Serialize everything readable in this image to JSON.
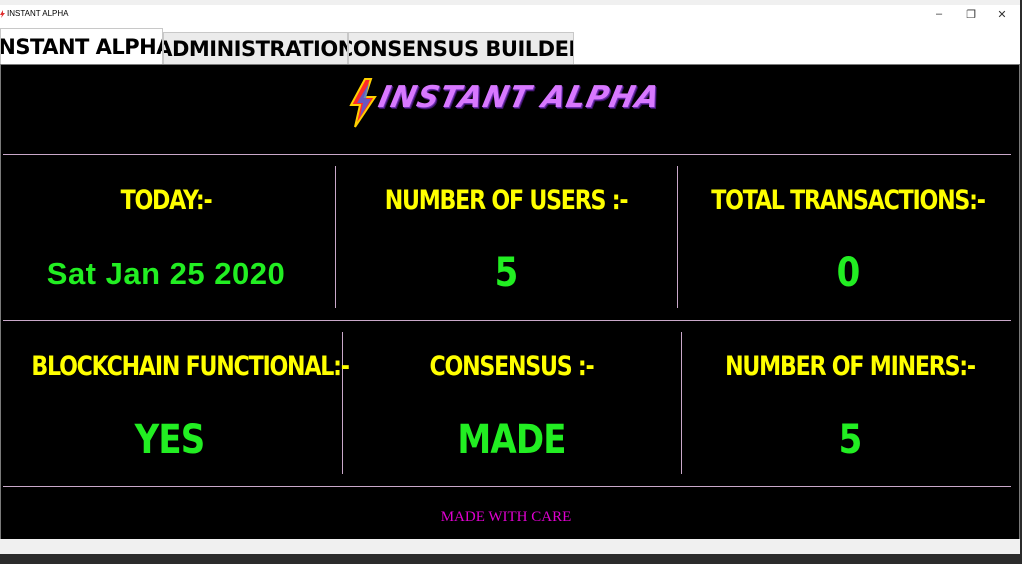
{
  "window": {
    "title": "INSTANT ALPHA",
    "controls": {
      "minimize": "–",
      "maximize": "❐",
      "close": "✕"
    }
  },
  "tabs": [
    {
      "label": "INSTANT ALPHA",
      "active": true
    },
    {
      "label": "ADMINISTRATION",
      "active": false
    },
    {
      "label": "CONSENSUS BUILDER",
      "active": false
    }
  ],
  "logo": {
    "text": "INSTANT ALPHA",
    "icon": "lightning-bolt-icon"
  },
  "stats": {
    "today": {
      "label": "TODAY:-",
      "value": "Sat Jan 25 2020"
    },
    "users": {
      "label": "NUMBER OF USERS :-",
      "value": "5"
    },
    "transactions": {
      "label": "TOTAL TRANSACTIONS:-",
      "value": "0"
    },
    "blockchain": {
      "label": "BLOCKCHAIN FUNCTIONAL:-",
      "value": "YES"
    },
    "consensus": {
      "label": "CONSENSUS :-",
      "value": "MADE"
    },
    "miners": {
      "label": "NUMBER OF MINERS:-",
      "value": "5"
    }
  },
  "footer": {
    "text": "MADE WITH CARE"
  },
  "colors": {
    "label": "#ffff00",
    "value": "#22ee22",
    "footer": "#e000d0",
    "background": "#000000"
  }
}
